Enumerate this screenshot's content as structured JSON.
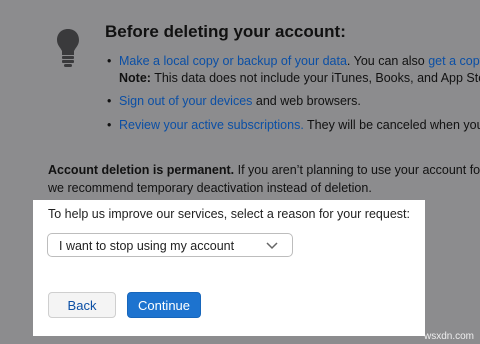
{
  "background_notice": {
    "heading": "Before deleting your account:",
    "bullets": [
      {
        "link": "Make a local copy or backup of your data",
        "text": ". You can also ",
        "link2": "get a copy",
        "note_label": "Note:",
        "note_text": " This data does not include your iTunes, Books, and App Store"
      },
      {
        "link": "Sign out of your devices",
        "text": " and web browsers."
      },
      {
        "link": "Review your active subscriptions.",
        "text": " They will be canceled when your"
      }
    ],
    "warning_bold": "Account deletion is permanent.",
    "warning_text": " If you aren’t planning to use your account for n",
    "warning_line2": "we recommend temporary deactivation instead of deletion."
  },
  "dialog": {
    "prompt": "To help us improve our services, select a reason for your request:",
    "reason_selected": "I want to stop using my account",
    "back_label": "Back",
    "continue_label": "Continue"
  },
  "watermark": "wsxdn.com",
  "colors": {
    "link": "#0b4fa5",
    "primary_button": "#1d73cf",
    "overlay": "#8c8c8e"
  },
  "icons": [
    "lightbulb-icon",
    "chevron-down-icon"
  ]
}
